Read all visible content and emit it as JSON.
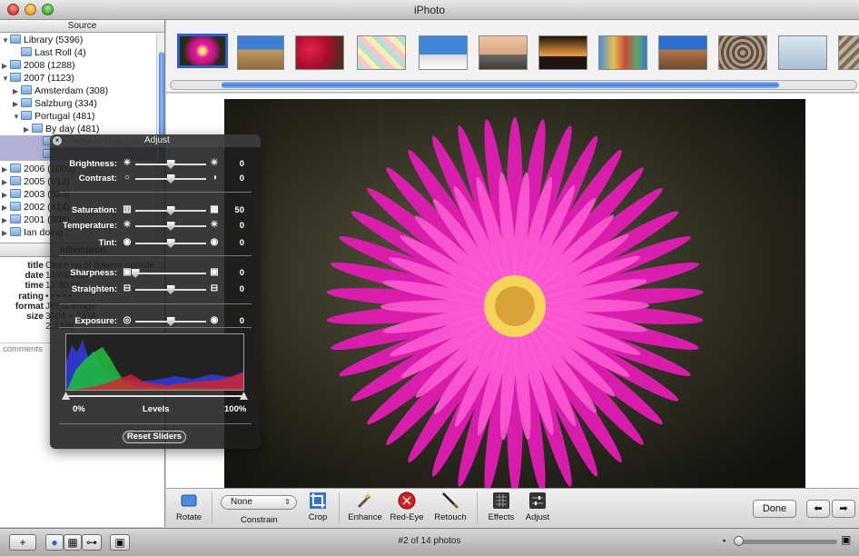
{
  "window": {
    "title": "iPhoto"
  },
  "sidebar": {
    "header": "Source",
    "items": [
      {
        "label": "Library (5396)",
        "expanded": true,
        "indent": 0
      },
      {
        "label": "Last Roll (4)",
        "expanded": null,
        "indent": 1
      },
      {
        "label": "2008 (1288)",
        "expanded": false,
        "indent": 0
      },
      {
        "label": "2007 (1123)",
        "expanded": true,
        "indent": 0
      },
      {
        "label": "Amsterdam (308)",
        "expanded": false,
        "indent": 1
      },
      {
        "label": "Salzburg (334)",
        "expanded": false,
        "indent": 1
      },
      {
        "label": "Portugal (481)",
        "expanded": true,
        "indent": 1
      },
      {
        "label": "By day (481)",
        "expanded": false,
        "indent": 2
      },
      {
        "label": "Amanda in Portugal (85)",
        "expanded": null,
        "indent": 3,
        "selected": true
      },
      {
        "label": "",
        "expanded": null,
        "indent": 3,
        "selected": true
      },
      {
        "label": "2006 (1003)",
        "expanded": false,
        "indent": 0
      },
      {
        "label": "2005 (613)",
        "expanded": false,
        "indent": 0
      },
      {
        "label": "2003 (523)",
        "expanded": false,
        "indent": 0
      },
      {
        "label": "2002 (414)",
        "expanded": false,
        "indent": 0
      },
      {
        "label": "2001 (308)",
        "expanded": false,
        "indent": 0
      },
      {
        "label": "Ian doing",
        "expanded": false,
        "indent": 0
      }
    ],
    "info_header": "Information",
    "info": [
      {
        "key": "title",
        "value": "Close up of flowers outside ..."
      },
      {
        "key": "date",
        "value": "14/05/2007"
      },
      {
        "key": "time",
        "value": "13:40:56"
      },
      {
        "key": "rating",
        "value": "• • • • •"
      },
      {
        "key": "format",
        "value": "JPEG image"
      },
      {
        "key": "size",
        "value": "3504 × 2336"
      },
      {
        "key": "",
        "value": "2.3 MB"
      }
    ],
    "comments_label": "comments"
  },
  "adjust": {
    "title": "Adjust",
    "groups": [
      [
        {
          "label": "Brightness:",
          "value": "0",
          "level": 0.5,
          "icon_lo": "☀",
          "icon_hi": "☀"
        },
        {
          "label": "Contrast:",
          "value": "0",
          "level": 0.5,
          "icon_lo": "○",
          "icon_hi": "◑"
        }
      ],
      [
        {
          "label": "Saturation:",
          "value": "50",
          "level": 0.5,
          "icon_lo": "▥",
          "icon_hi": "▦"
        },
        {
          "label": "Temperature:",
          "value": "0",
          "level": 0.5,
          "icon_lo": "✳",
          "icon_hi": "✳"
        },
        {
          "label": "Tint:",
          "value": "0",
          "level": 0.5,
          "icon_lo": "◉",
          "icon_hi": "◉"
        }
      ],
      [
        {
          "label": "Sharpness:",
          "value": "0",
          "level": 0.0,
          "icon_lo": "▣",
          "icon_hi": "▣"
        },
        {
          "label": "Straighten:",
          "value": "0",
          "level": 0.5,
          "icon_lo": "⊟",
          "icon_hi": "⊟"
        }
      ],
      [
        {
          "label": "Exposure:",
          "value": "0",
          "level": 0.5,
          "icon_lo": "◎",
          "icon_hi": "◉"
        }
      ]
    ],
    "levels_min": "0%",
    "levels_label": "Levels",
    "levels_max": "100%",
    "reset_label": "Reset Sliders"
  },
  "toolbar": {
    "rotate": "Rotate",
    "constrain_value": "None",
    "constrain_label": "Constrain",
    "crop": "Crop",
    "enhance": "Enhance",
    "redeye": "Red-Eye",
    "retouch": "Retouch",
    "effects": "Effects",
    "adjust": "Adjust",
    "done": "Done"
  },
  "footer": {
    "count_text": "#2 of 14 photos"
  },
  "colors": {
    "accent": "#3a77dc",
    "flower": "#e81fb6",
    "selection": "#b5b0d6"
  }
}
